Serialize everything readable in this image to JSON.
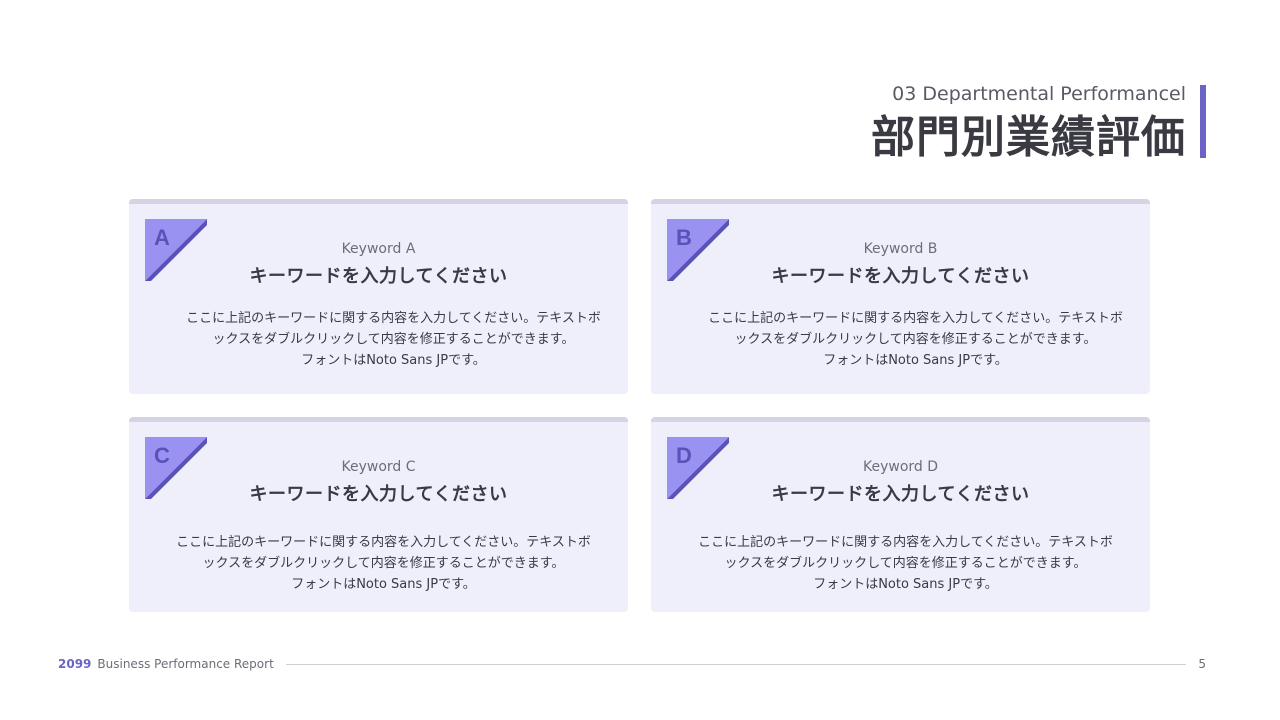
{
  "header": {
    "subtitle": "03 Departmental Performancel",
    "title": "部門別業績評価"
  },
  "colors": {
    "accent": "#6b63c7",
    "badge_light": "#9a92f0",
    "badge_dark": "#5a52b8",
    "card_bg": "#efeefb"
  },
  "cards": [
    {
      "letter": "A",
      "keyword": "Keyword A",
      "heading": "キーワードを入力してください",
      "body_line1": "ここに上記のキーワードに関する内容を入力してください。テキストボ",
      "body_line2": "ックスをダブルクリックして内容を修正することができます。",
      "body_line3": "フォントはNoto Sans JPです。"
    },
    {
      "letter": "B",
      "keyword": "Keyword B",
      "heading": "キーワードを入力してください",
      "body_line1": "ここに上記のキーワードに関する内容を入力してください。テキストボ",
      "body_line2": "ックスをダブルクリックして内容を修正することができます。",
      "body_line3": "フォントはNoto Sans JPです。"
    },
    {
      "letter": "C",
      "keyword": "Keyword C",
      "heading": "キーワードを入力してください",
      "body_line1": "ここに上記のキーワードに関する内容を入力してください。テキストボ",
      "body_line2": "ックスをダブルクリックして内容を修正することができます。",
      "body_line3": "フォントはNoto Sans JPです。"
    },
    {
      "letter": "D",
      "keyword": "Keyword D",
      "heading": "キーワードを入力してください",
      "body_line1": "ここに上記のキーワードに関する内容を入力してください。テキストボ",
      "body_line2": "ックスをダブルクリックして内容を修正することができます。",
      "body_line3": "フォントはNoto Sans JPです。"
    }
  ],
  "footer": {
    "year": "2099",
    "report": "Business Performance Report",
    "page": "5"
  }
}
